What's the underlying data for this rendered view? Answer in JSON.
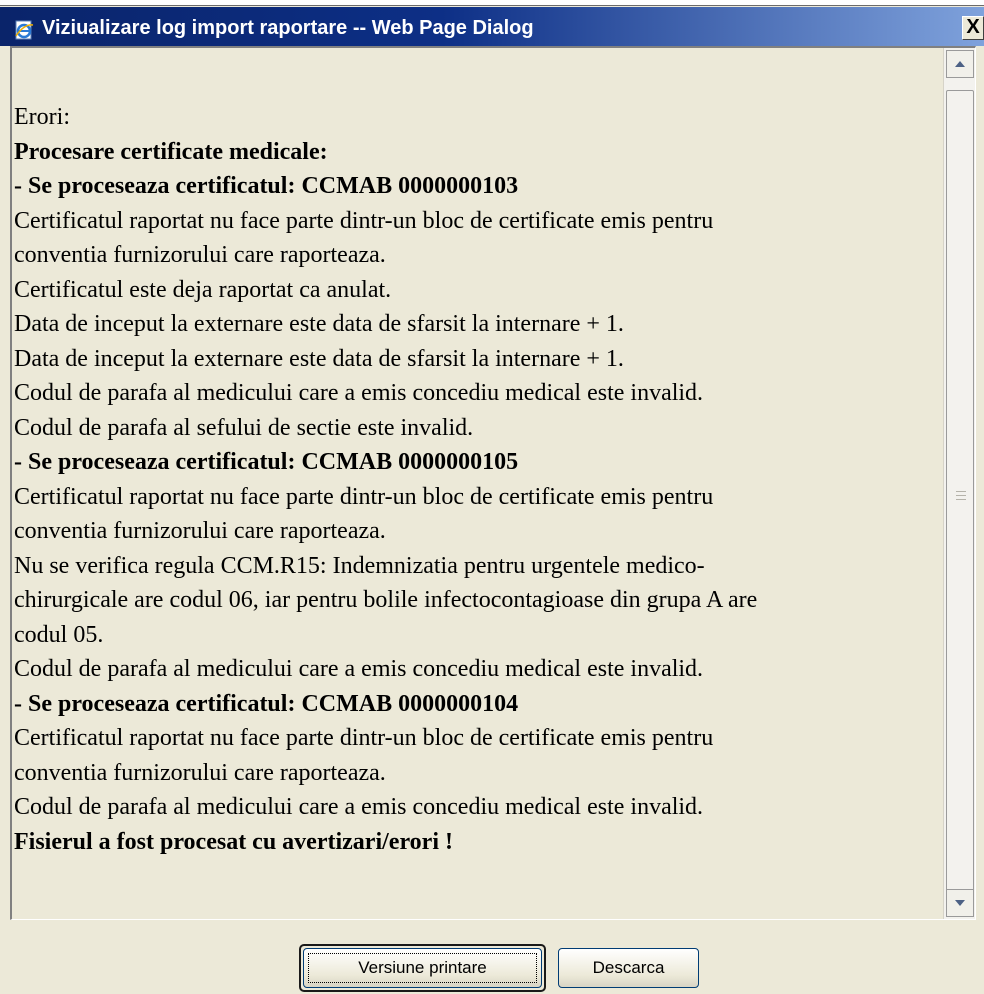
{
  "window": {
    "title": "Viziualizare log import raportare -- Web Page Dialog",
    "close_glyph": "X"
  },
  "log": [
    {
      "text": "Erori:",
      "bold": false
    },
    {
      "text": "Procesare certificate medicale:",
      "bold": true
    },
    {
      "text": "- Se proceseaza certificatul: CCMAB 0000000103",
      "bold": true
    },
    {
      "text": "Certificatul raportat nu face parte dintr-un bloc de certificate emis pentru",
      "bold": false
    },
    {
      "text": "conventia furnizorului care raporteaza.",
      "bold": false
    },
    {
      "text": "Certificatul este deja raportat ca anulat.",
      "bold": false
    },
    {
      "text": "Data de inceput la externare este data de sfarsit la internare + 1.",
      "bold": false
    },
    {
      "text": "Data de inceput la externare este data de sfarsit la internare + 1.",
      "bold": false
    },
    {
      "text": "Codul de parafa al medicului care a emis concediu medical este invalid.",
      "bold": false
    },
    {
      "text": "Codul de parafa al sefului de sectie este invalid.",
      "bold": false
    },
    {
      "text": "- Se proceseaza certificatul: CCMAB 0000000105",
      "bold": true
    },
    {
      "text": "Certificatul raportat nu face parte dintr-un bloc de certificate emis pentru",
      "bold": false
    },
    {
      "text": "conventia furnizorului care raporteaza.",
      "bold": false
    },
    {
      "text": "Nu se verifica regula CCM.R15: Indemnizatia pentru urgentele medico-",
      "bold": false
    },
    {
      "text": "chirurgicale are codul 06, iar pentru bolile infectocontagioase din grupa A are",
      "bold": false
    },
    {
      "text": "codul 05.",
      "bold": false
    },
    {
      "text": "Codul de parafa al medicului care a emis concediu medical este invalid.",
      "bold": false
    },
    {
      "text": "- Se proceseaza certificatul: CCMAB 0000000104",
      "bold": true
    },
    {
      "text": "Certificatul raportat nu face parte dintr-un bloc de certificate emis pentru",
      "bold": false
    },
    {
      "text": "conventia furnizorului care raporteaza.",
      "bold": false
    },
    {
      "text": "Codul de parafa al medicului care a emis concediu medical este invalid.",
      "bold": false
    },
    {
      "text": "Fisierul a fost procesat cu avertizari/erori !",
      "bold": true
    }
  ],
  "buttons": {
    "print_label": "Versiune printare",
    "download_label": "Descarca"
  },
  "icons": {
    "title": "ie-page-icon",
    "scroll_up": "scroll-up-arrow-icon",
    "scroll_down": "scroll-down-arrow-icon"
  }
}
